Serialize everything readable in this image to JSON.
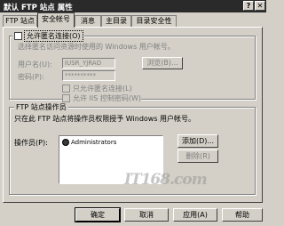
{
  "window": {
    "title": "默认 FTP 站点 属性",
    "help_glyph": "?",
    "close_glyph": "✕"
  },
  "tabs": [
    {
      "label": "FTP 站点",
      "active": false
    },
    {
      "label": "安全帐号",
      "active": true
    },
    {
      "label": "消息",
      "active": false
    },
    {
      "label": "主目录",
      "active": false
    },
    {
      "label": "目录安全性",
      "active": false
    }
  ],
  "anonymous": {
    "checkbox_label": "允许匿名连接(O)",
    "checked": false,
    "description": "选择匿名访问资源时使用的 Windows 用户帐号。",
    "username_label": "用户名(U):",
    "username_value": "IUSR_YJRAO",
    "browse_label": "浏览(B)...",
    "password_label": "密码(P):",
    "password_value": "**********",
    "only_anonymous_label": "只允许匿名连接(L)",
    "iis_control_label": "允许 IIS 控制密码(W)"
  },
  "operators": {
    "group_title": "FTP 站点操作员",
    "description": "只在此 FTP 站点将操作员权限授予 Windows 用户帐号。",
    "operators_label": "操作员(P):",
    "items": [
      "Administrators"
    ],
    "add_label": "添加(D)...",
    "remove_label": "删除(R)"
  },
  "footer": {
    "ok_label": "确定",
    "cancel_label": "取消",
    "apply_label": "应用(A)",
    "help_label": "帮助"
  },
  "watermark": "IT168.com"
}
